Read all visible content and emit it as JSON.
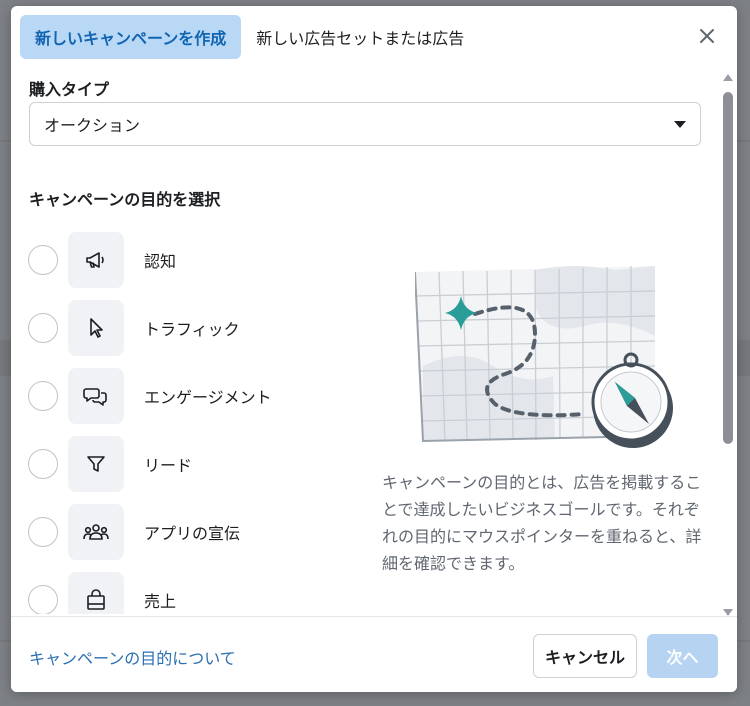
{
  "tabs": [
    {
      "label": "新しいキャンペーンを作成",
      "active": true
    },
    {
      "label": "新しい広告セットまたは広告",
      "active": false
    }
  ],
  "purchase_type": {
    "label": "購入タイプ",
    "value": "オークション"
  },
  "objectives": {
    "heading": "キャンペーンの目的を選択",
    "items": [
      {
        "label": "認知",
        "icon": "megaphone-icon"
      },
      {
        "label": "トラフィック",
        "icon": "cursor-icon"
      },
      {
        "label": "エンゲージメント",
        "icon": "chat-bubbles-icon"
      },
      {
        "label": "リード",
        "icon": "funnel-icon"
      },
      {
        "label": "アプリの宣伝",
        "icon": "people-icon"
      },
      {
        "label": "売上",
        "icon": "shopping-bag-icon"
      }
    ],
    "description": "キャンペーンの目的とは、広告を掲載することで達成したいビジネスゴールです。それぞれの目的にマウスポインターを重ねると、詳細を確認できます。"
  },
  "footer": {
    "link": "キャンペーンの目的について",
    "cancel": "キャンセル",
    "next": "次へ"
  },
  "colors": {
    "active_tab_bg": "#b9d8f5",
    "active_tab_text": "#1265b1",
    "link": "#2b6fb3",
    "next_disabled_bg": "#b6d3f2",
    "map_accent": "#2a9d99"
  }
}
